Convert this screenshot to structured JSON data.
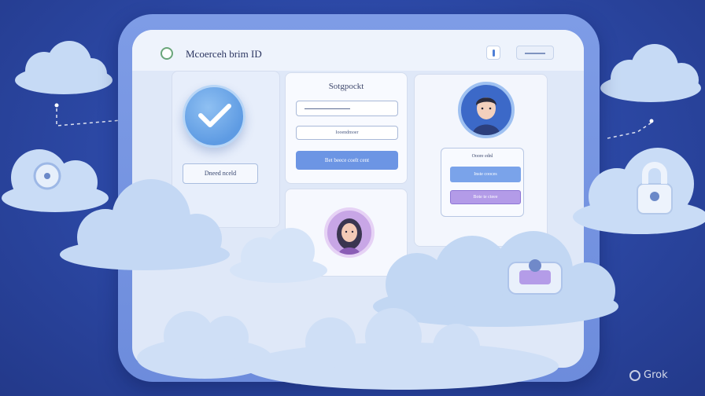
{
  "app": {
    "title": "Mcoerceh brim ID"
  },
  "left_panel": {
    "button_label": "Dneed nceld"
  },
  "form_panel": {
    "title": "Sotgpockt",
    "field_2_value": "Iooendmoer",
    "submit_label": "Bet beece coelt cent"
  },
  "right_panel": {
    "box_title": "Ooore ednl",
    "primary_label": "Inste cooces",
    "secondary_label": "Bote te cteee"
  },
  "watermark": "Grok",
  "colors": {
    "background": "#2d4aa8",
    "window_frame": "#7e9ce6",
    "accent_blue": "#6c95e4",
    "accent_purple": "#b39be8",
    "cloud": "#c9dcf6"
  },
  "icons": [
    "check-icon",
    "lock-icon",
    "user-icon",
    "cloud-icon",
    "unlock-icon"
  ]
}
